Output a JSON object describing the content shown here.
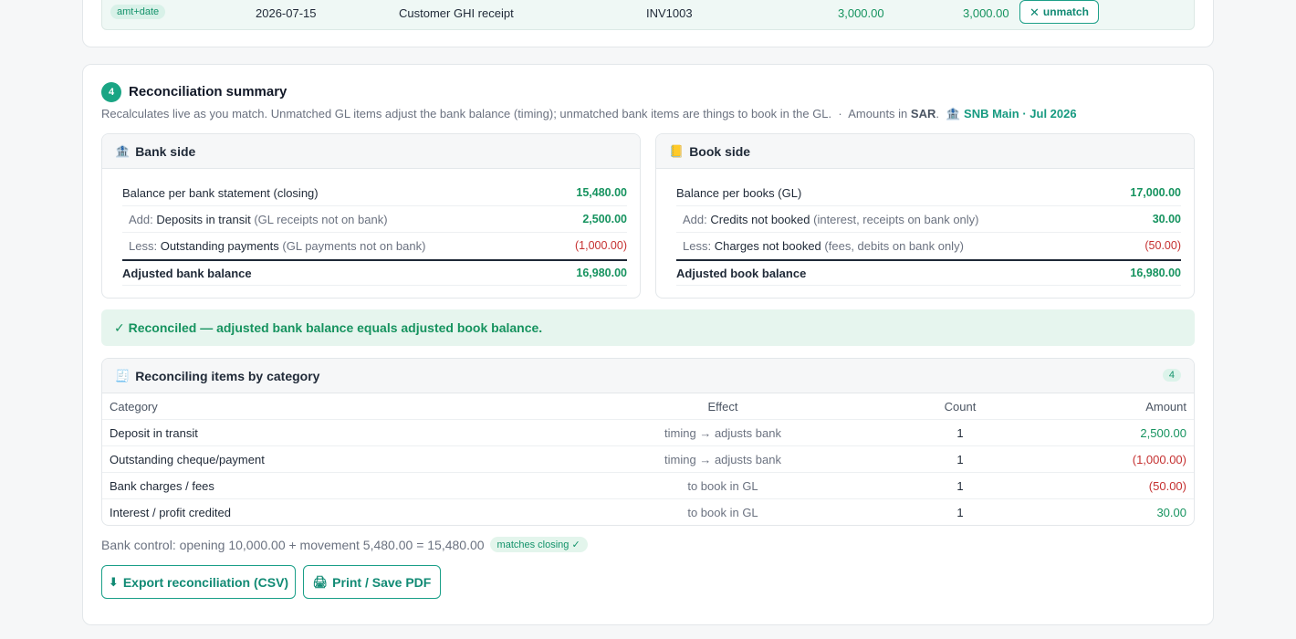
{
  "top_row": {
    "tag": "amt+date",
    "date": "2026-07-15",
    "description": "Customer GHI receipt",
    "reference": "INV1003",
    "amount_1": "3,000.00",
    "amount_2": "3,000.00",
    "unmatch_label": "unmatch"
  },
  "summary": {
    "step": "4",
    "title": "Reconciliation summary",
    "subtitle": "Recalculates live as you match. Unmatched GL items adjust the bank balance (timing); unmatched bank items are things to book in the GL.",
    "sep": "·",
    "amounts_prefix": "Amounts in",
    "currency": "SAR",
    "amounts_suffix": ".",
    "account": "SNB Main · Jul 2026"
  },
  "bank_side": {
    "title": "Bank side",
    "balance_label": "Balance per bank statement (closing)",
    "balance": "15,480.00",
    "add_prefix": "Add:",
    "add_label": "Deposits in transit",
    "add_note": "(GL receipts not on bank)",
    "add_amount": "2,500.00",
    "less_prefix": "Less:",
    "less_label": "Outstanding payments",
    "less_note": "(GL payments not on bank)",
    "less_amount": "(1,000.00)",
    "adjusted_label": "Adjusted bank balance",
    "adjusted": "16,980.00"
  },
  "book_side": {
    "title": "Book side",
    "balance_label": "Balance per books (GL)",
    "balance": "17,000.00",
    "add_prefix": "Add:",
    "add_label": "Credits not booked",
    "add_note": "(interest, receipts on bank only)",
    "add_amount": "30.00",
    "less_prefix": "Less:",
    "less_label": "Charges not booked",
    "less_note": "(fees, debits on bank only)",
    "less_amount": "(50.00)",
    "adjusted_label": "Adjusted book balance",
    "adjusted": "16,980.00"
  },
  "status": {
    "text": "✓ Reconciled — adjusted bank balance equals adjusted book balance."
  },
  "categories": {
    "title": "Reconciling items by category",
    "count": "4",
    "headers": {
      "category": "Category",
      "effect": "Effect",
      "count": "Count",
      "amount": "Amount"
    },
    "rows": [
      {
        "category": "Deposit in transit",
        "effect": "timing → adjusts bank",
        "count": "1",
        "amount": "2,500.00"
      },
      {
        "category": "Outstanding cheque/payment",
        "effect": "timing → adjusts bank",
        "count": "1",
        "amount": "(1,000.00)"
      },
      {
        "category": "Bank charges / fees",
        "effect": "to book in GL",
        "count": "1",
        "amount": "(50.00)"
      },
      {
        "category": "Interest / profit credited",
        "effect": "to book in GL",
        "count": "1",
        "amount": "30.00"
      }
    ]
  },
  "control": {
    "text": "Bank control: opening 10,000.00 + movement 5,480.00 = 15,480.00",
    "badge": "matches closing ✓"
  },
  "actions": {
    "export_label": "Export reconciliation (CSV)",
    "print_label": "Print / Save PDF"
  },
  "colors": {
    "accent": "#1aa584",
    "positive": "#16935f",
    "negative": "#c53030"
  }
}
